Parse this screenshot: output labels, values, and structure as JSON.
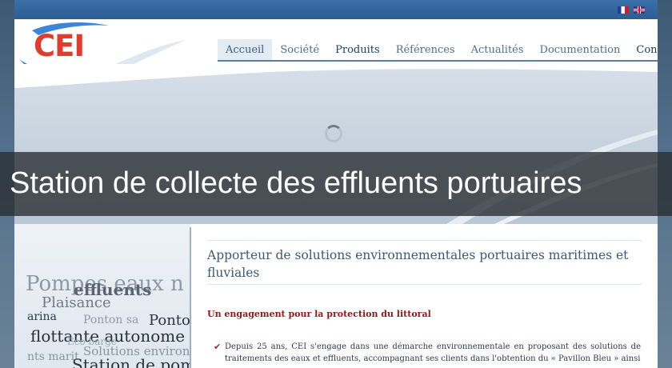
{
  "flags": [
    {
      "lang": "fr",
      "icon": "flag-fr-icon"
    },
    {
      "lang": "en",
      "icon": "flag-uk-icon"
    }
  ],
  "logo": {
    "text": "CEI",
    "color": "#e03b2c"
  },
  "nav": {
    "items": [
      {
        "label": "Accueil",
        "active": true
      },
      {
        "label": "Société",
        "active": false
      },
      {
        "label": "Produits",
        "active": false
      },
      {
        "label": "Références",
        "active": false
      },
      {
        "label": "Actualités",
        "active": false
      },
      {
        "label": "Documentation",
        "active": false
      },
      {
        "label": "Contact",
        "active": false
      }
    ]
  },
  "banner": {
    "title": "Station de collecte des effluents portuaires"
  },
  "left_art": {
    "lines": [
      "Pompes eaux n",
      "effluents",
      "Plaisance",
      "arina",
      "Ponton sa",
      "Ponto",
      "flottante autonome",
      "Eco barge",
      "nts marit",
      "Solutions environ",
      "Station de pom"
    ]
  },
  "content": {
    "heading": "Apporteur de solutions environnementales portuaires maritimes et fluviales",
    "subheading": "Un engagement pour la protection du littoral",
    "bullet": "Depuis 25 ans, CEI s'engage dans une démarche environnementale en proposant des solutions de traitements des eaux et effluents, accompagnant ses clients dans l'obtention du « Pavillon Bleu » ainsi"
  },
  "colors": {
    "topbar": "#2d5d93",
    "nav_text": "#4e6f8c",
    "heading": "#3d5976",
    "subheading": "#8c1a1a",
    "banner_bg": "#282c30"
  }
}
